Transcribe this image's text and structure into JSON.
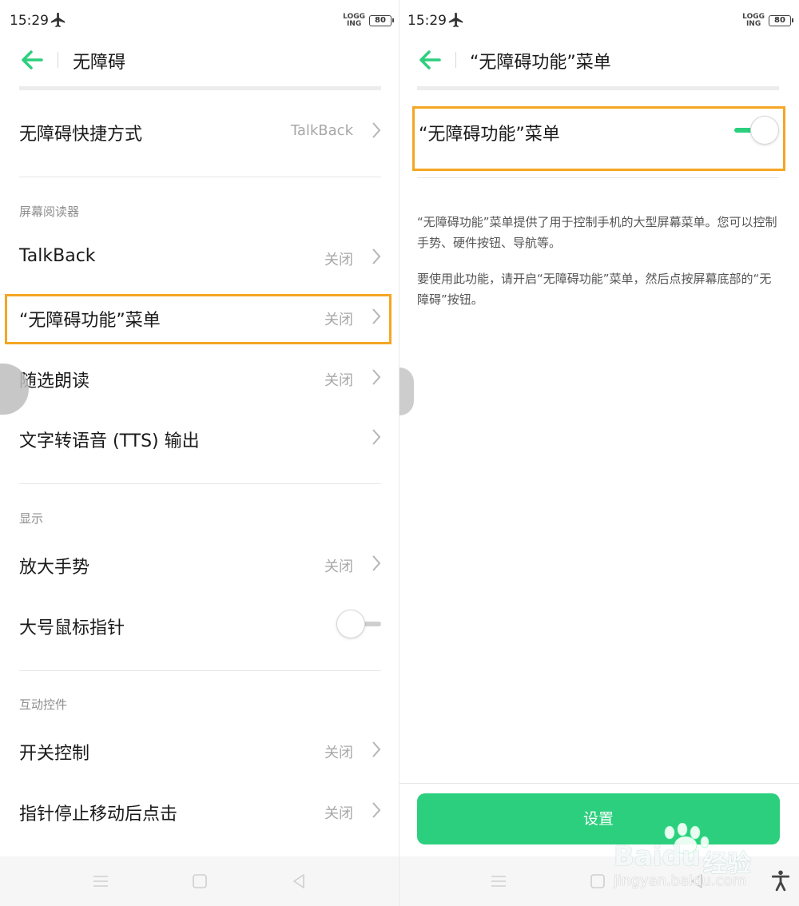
{
  "status_bar": {
    "time": "15:29",
    "icons": [
      "airplane-icon"
    ],
    "logging_line1": "LOGG",
    "logging_line2": "ING",
    "battery": "80"
  },
  "left_screen": {
    "title": "无障碍",
    "rows": [
      {
        "label": "无障碍快捷方式",
        "value": "TalkBack"
      },
      {
        "label": "TalkBack",
        "value": "关闭"
      },
      {
        "label": "“无障碍功能”菜单",
        "value": "关闭"
      },
      {
        "label": "随选朗读",
        "value": "关闭"
      },
      {
        "label": "文字转语音 (TTS) 输出",
        "value": ""
      },
      {
        "label": "放大手势",
        "value": "关闭"
      },
      {
        "label": "大号鼠标指针",
        "toggle": false
      },
      {
        "label": "开关控制",
        "value": "关闭"
      },
      {
        "label": "指针停止移动后点击",
        "value": "关闭"
      }
    ],
    "sections": {
      "screen_reader": "屏幕阅读器",
      "display": "显示",
      "interaction": "互动控件"
    }
  },
  "right_screen": {
    "title": "“无障碍功能”菜单",
    "toggle_label": "“无障碍功能”菜单",
    "toggle_on": true,
    "description_1": "“无障碍功能”菜单提供了用于控制手机的大型屏幕菜单。您可以控制手势、硬件按钮、导航等。",
    "description_2": "要使用此功能，请开启“无障碍功能”菜单，然后点按屏幕底部的“无障碍”按钮。",
    "button_label": "设置"
  },
  "watermark": {
    "brand": "Baidu",
    "brand_cn": "经验",
    "url": "jingyan.baidu.com"
  },
  "colors": {
    "accent": "#2ccf7d",
    "highlight": "#f5a623",
    "secondary_text": "#a8a8a8"
  }
}
